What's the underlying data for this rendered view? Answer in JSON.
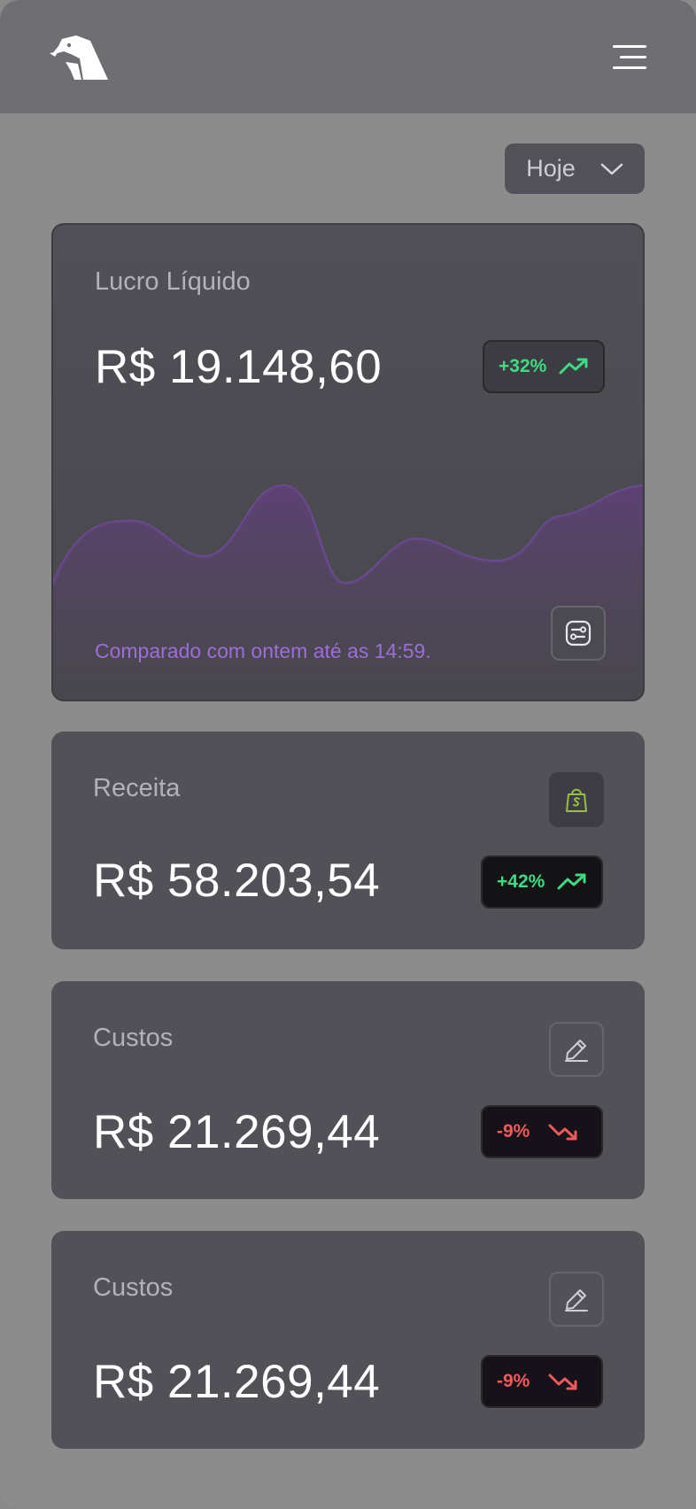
{
  "header": {
    "logo_icon": "eagle-logo-icon",
    "menu_icon": "hamburger-menu-icon"
  },
  "period_selector": {
    "label": "Hoje",
    "icon": "chevron-down-icon"
  },
  "cards": {
    "profit": {
      "title": "Lucro Líquido",
      "value": "R$ 19.148,60",
      "change": "+32%",
      "trend": "up",
      "comparison_note": "Comparado com ontem até as 14:59.",
      "settings_icon": "sliders-settings-icon",
      "chart_color": "#7a4fae"
    },
    "revenue": {
      "title": "Receita",
      "value": "R$ 58.203,54",
      "change": "+42%",
      "trend": "up",
      "source_icon": "shopify-bag-icon",
      "source_color": "#95bf47"
    },
    "costs_1": {
      "title": "Custos",
      "value": "R$ 21.269,44",
      "change": "-9%",
      "trend": "down",
      "edit_icon": "pencil-edit-icon"
    },
    "costs_2": {
      "title": "Custos",
      "value": "R$ 21.269,44",
      "change": "-9%",
      "trend": "down",
      "edit_icon": "pencil-edit-icon"
    }
  },
  "colors": {
    "positive": "#3ddc84",
    "negative": "#ef5a5a",
    "accent_purple": "#9e6ed6"
  }
}
